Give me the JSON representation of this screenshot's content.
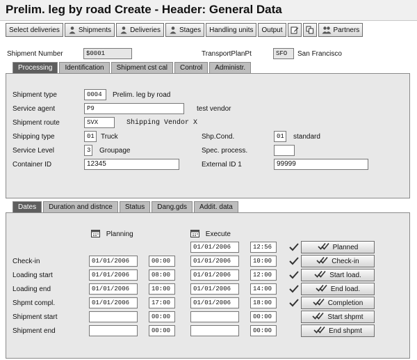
{
  "window": {
    "title": "Prelim. leg by road Create - Header: General Data"
  },
  "toolbar": {
    "select_deliveries": "Select deliveries",
    "shipments": "Shipments",
    "deliveries": "Deliveries",
    "stages": "Stages",
    "handling_units": "Handling units",
    "output": "Output",
    "partners": "Partners"
  },
  "header": {
    "shipment_number_label": "Shipment Number",
    "shipment_number": "$0001",
    "transport_plan_pt_label": "TransportPlanPt",
    "transport_plan_pt_code": "SFO",
    "transport_plan_pt_name": "San Francisco"
  },
  "tabs_top": [
    {
      "label": "Processing",
      "active": true
    },
    {
      "label": "Identification",
      "active": false
    },
    {
      "label": "Shipment cst cal",
      "active": false
    },
    {
      "label": "Control",
      "active": false
    },
    {
      "label": "Administr.",
      "active": false
    }
  ],
  "processing": {
    "shipment_type_label": "Shipment type",
    "shipment_type": "0004",
    "shipment_type_text": "Prelim. leg by road",
    "service_agent_label": "Service agent",
    "service_agent": "P9",
    "service_agent_text": "test vendor",
    "shipment_route_label": "Shipment route",
    "shipment_route": "SVX",
    "shipment_route_text": "Shipping Vendor X",
    "shipping_type_label": "Shipping type",
    "shipping_type": "01",
    "shipping_type_text": "Truck",
    "shp_cond_label": "Shp.Cond.",
    "shp_cond": "01",
    "shp_cond_text": "standard",
    "service_level_label": "Service Level",
    "service_level": "3",
    "service_level_text": "Groupage",
    "spec_process_label": "Spec. process.",
    "spec_process": "",
    "container_id_label": "Container ID",
    "container_id": "12345",
    "external_id_label": "External ID 1",
    "external_id": "99999"
  },
  "tabs_bottom": [
    {
      "label": "Dates",
      "active": true
    },
    {
      "label": "Duration and distnce",
      "active": false
    },
    {
      "label": "Status",
      "active": false
    },
    {
      "label": "Dang.gds",
      "active": false
    },
    {
      "label": "Addit. data",
      "active": false
    }
  ],
  "dates": {
    "planning_label": "Planning",
    "execute_label": "Execute",
    "planned_row": {
      "exec_date": "01/01/2006",
      "exec_time": "12:56",
      "button": "Planned",
      "checked": true
    },
    "rows": [
      {
        "label": "Check-in",
        "plan_date": "01/01/2006",
        "plan_time": "00:00",
        "exec_date": "01/01/2006",
        "exec_time": "10:00",
        "button": "Check-in",
        "checked": true
      },
      {
        "label": "Loading start",
        "plan_date": "01/01/2006",
        "plan_time": "08:00",
        "exec_date": "01/01/2006",
        "exec_time": "12:00",
        "button": "Start load.",
        "checked": true
      },
      {
        "label": "Loading end",
        "plan_date": "01/01/2006",
        "plan_time": "10:00",
        "exec_date": "01/01/2006",
        "exec_time": "14:00",
        "button": "End load.",
        "checked": true
      },
      {
        "label": "Shpmt compl.",
        "plan_date": "01/01/2006",
        "plan_time": "17:00",
        "exec_date": "01/01/2006",
        "exec_time": "18:00",
        "button": "Completion",
        "checked": true
      },
      {
        "label": "Shipment start",
        "plan_date": "",
        "plan_time": "00:00",
        "exec_date": "",
        "exec_time": "00:00",
        "button": "Start shpmt",
        "checked": false
      },
      {
        "label": "Shipment end",
        "plan_date": "",
        "plan_time": "00:00",
        "exec_date": "",
        "exec_time": "00:00",
        "button": "End shpmt",
        "checked": false
      }
    ]
  },
  "icons": {
    "shipments": "person-icon",
    "deliveries": "person-icon",
    "stages": "person-icon",
    "edit": "edit-icon",
    "copy": "copy-icon",
    "partners": "partners-icon",
    "calendar": "calendar-icon",
    "check": "check-icon",
    "button_check": "double-check-icon"
  }
}
